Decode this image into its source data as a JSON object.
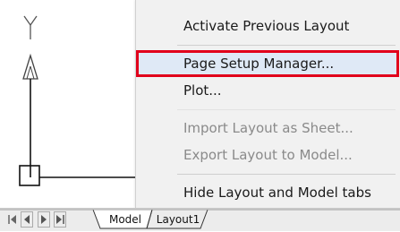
{
  "context_menu": {
    "items": [
      {
        "label": "Activate Previous Layout",
        "enabled": true
      },
      {
        "label": "Page Setup Manager...",
        "enabled": true,
        "highlighted": true
      },
      {
        "label": "Plot...",
        "enabled": true
      },
      {
        "label": "Import Layout as Sheet...",
        "enabled": false
      },
      {
        "label": "Export Layout to Model...",
        "enabled": false
      },
      {
        "label": "Hide Layout and Model tabs",
        "enabled": true
      }
    ]
  },
  "tabs": [
    {
      "label": "Model",
      "active": true
    },
    {
      "label": "Layout1",
      "active": false
    }
  ],
  "colors": {
    "highlight_border": "#e1001b",
    "highlight_fill": "#dfe9f6",
    "menu_background": "#f1f1f1",
    "disabled_text": "#8a8a8a"
  },
  "icons": [
    "ucs-icon",
    "first-tab-icon",
    "previous-tab-icon",
    "next-tab-icon",
    "last-tab-icon"
  ]
}
